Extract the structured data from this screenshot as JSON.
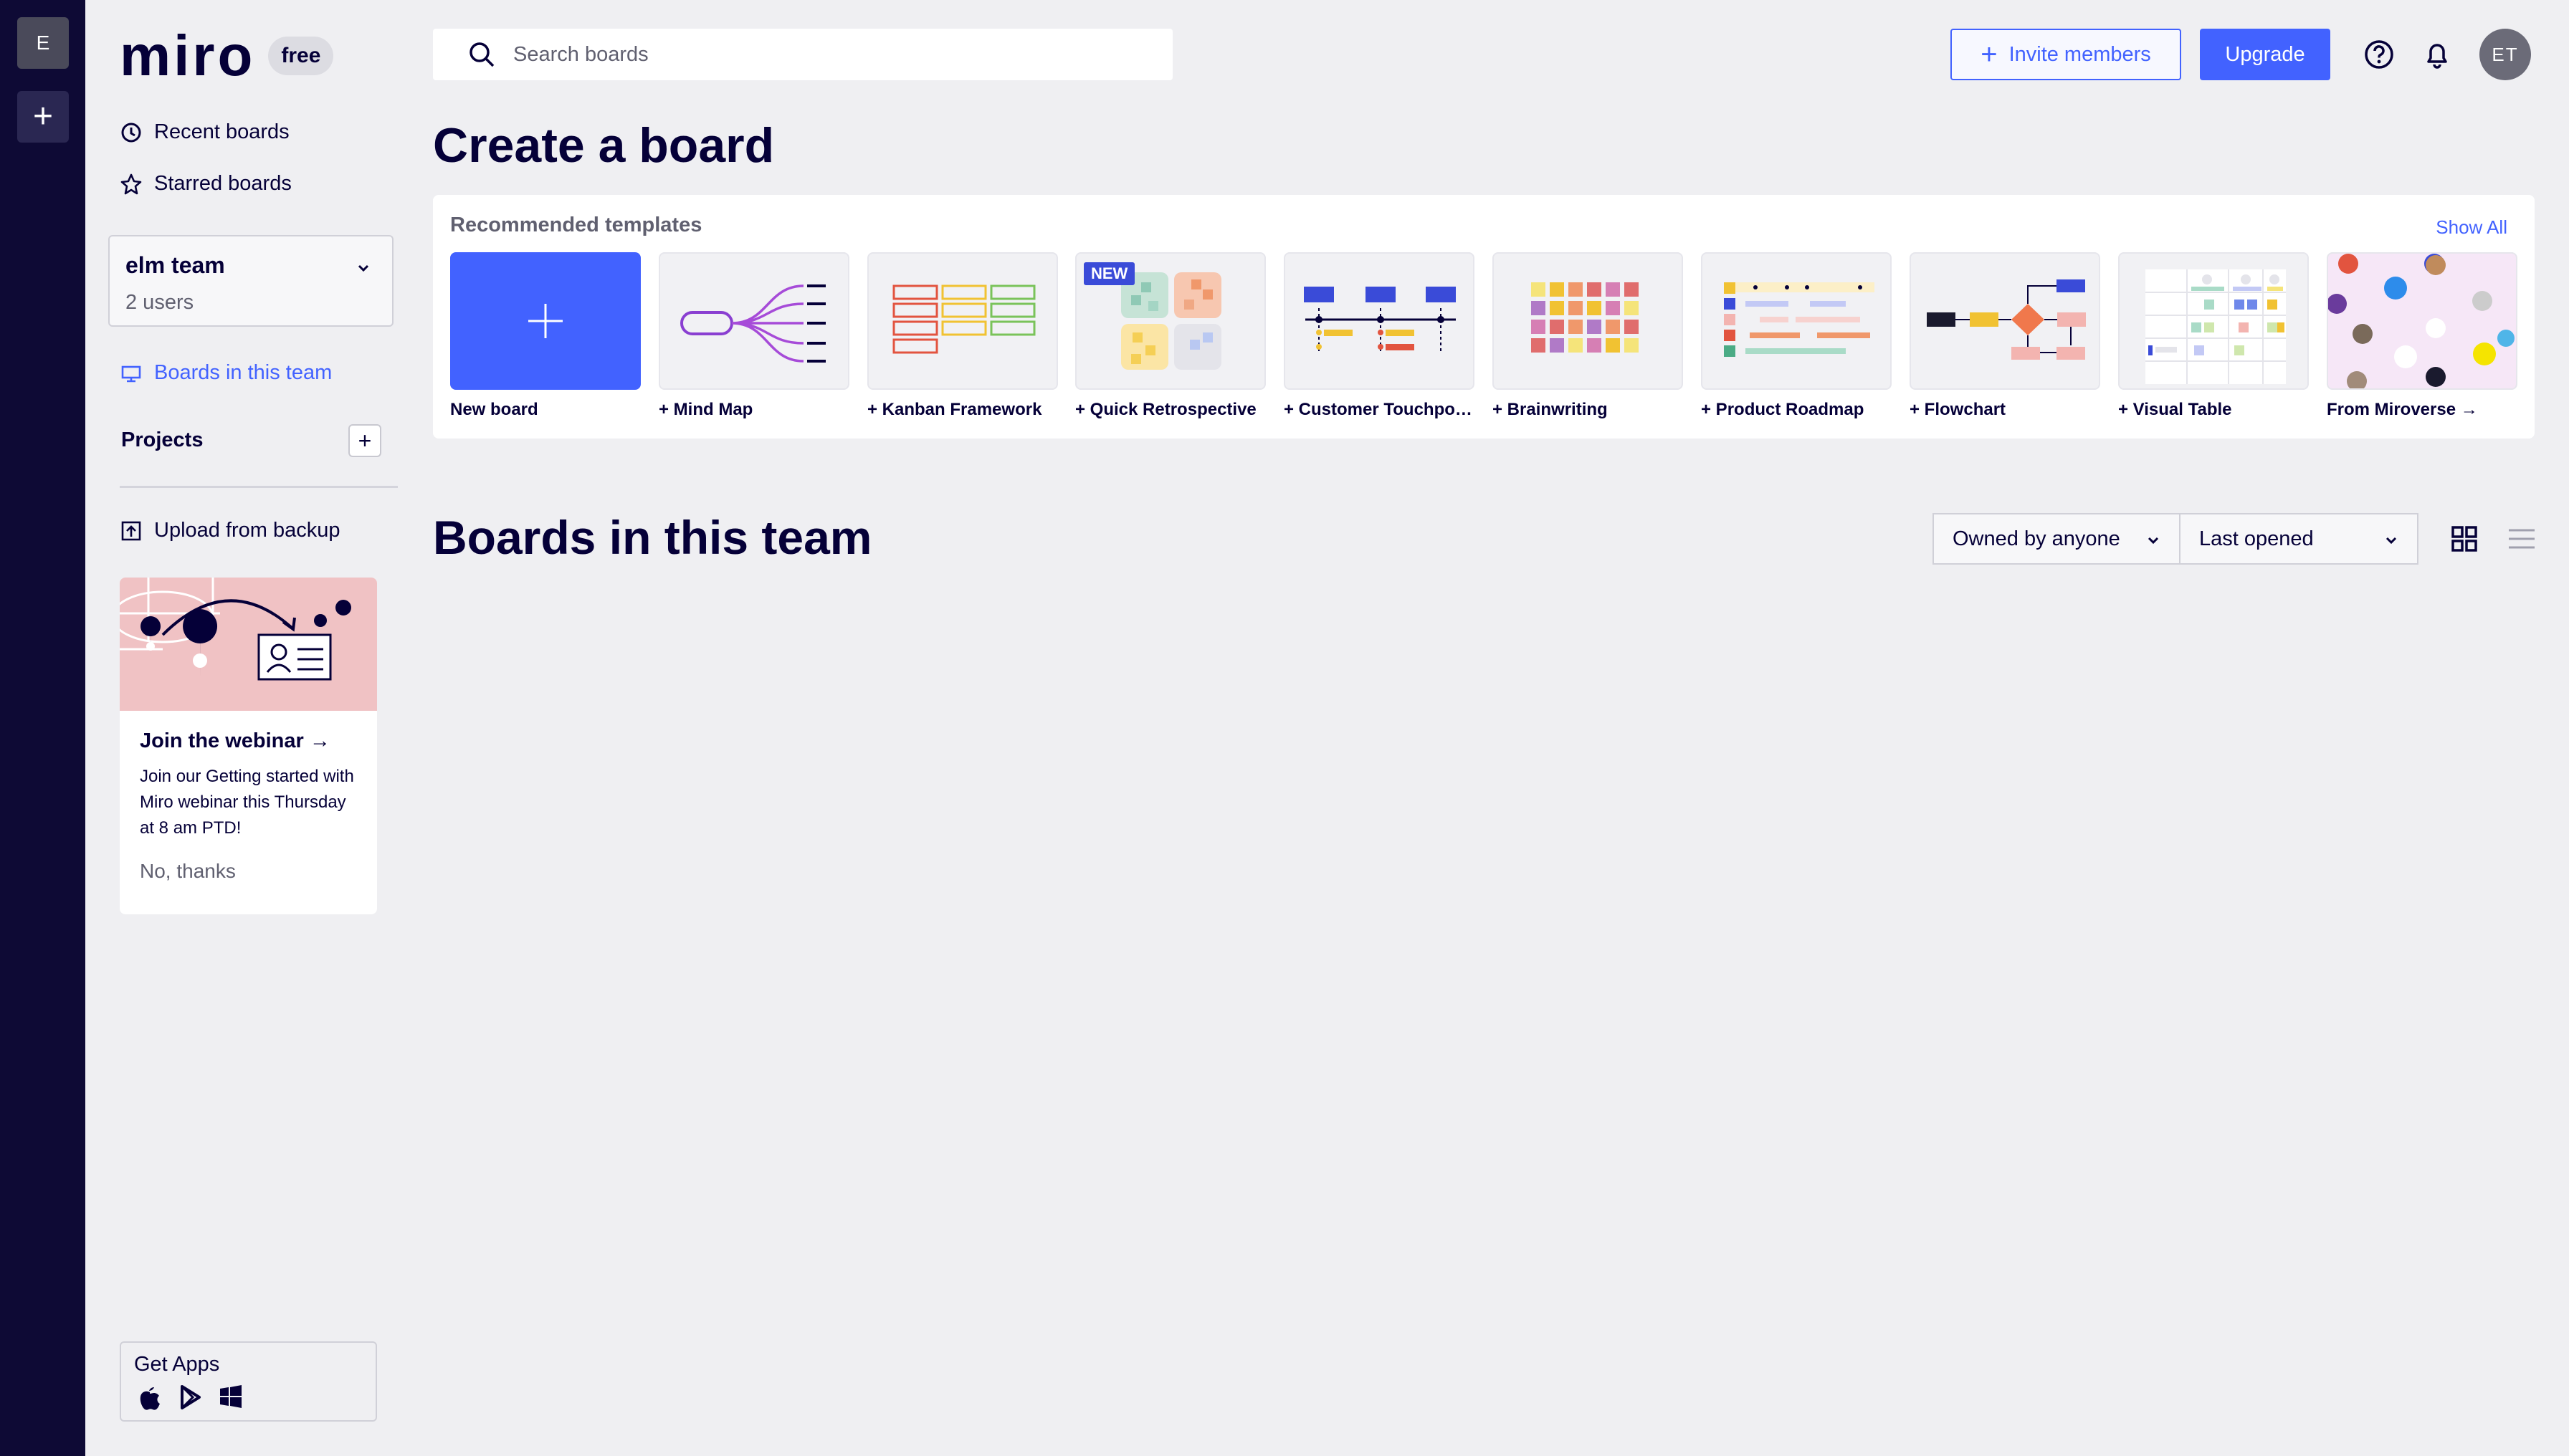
{
  "rail": {
    "team_initial": "E",
    "add_symbol": "+"
  },
  "logo": {
    "wordmark": "miro",
    "plan": "free"
  },
  "sidebar": {
    "recent": "Recent boards",
    "starred": "Starred boards",
    "team": {
      "name": "elm team",
      "users": "2 users"
    },
    "boards_in_team": "Boards in this team",
    "projects": "Projects",
    "projects_add": "+",
    "upload": "Upload from backup",
    "promo": {
      "title": "Join the webinar →",
      "body": "Join our Getting started with Miro webinar this Thursday at 8 am PTD!",
      "dismiss": "No, thanks"
    },
    "get_apps": "Get Apps"
  },
  "header": {
    "search_placeholder": "Search boards",
    "invite": "Invite members",
    "upgrade": "Upgrade",
    "avatar": "ET"
  },
  "create": {
    "title": "Create a board",
    "recommended": "Recommended templates",
    "show_all": "Show All",
    "badge_new": "NEW",
    "templates": [
      "New board",
      "+ Mind Map",
      "+ Kanban Framework",
      "+ Quick Retrospective",
      "+ Customer Touchpoint Map",
      "+ Brainwriting",
      "+ Product Roadmap",
      "+ Flowchart",
      "+ Visual Table",
      "From Miroverse →"
    ]
  },
  "boards": {
    "title": "Boards in this team",
    "owner_filter": "Owned by anyone",
    "sort": "Last opened"
  },
  "colors": {
    "accent": "#4262ff",
    "rail": "#0e0a35",
    "text": "#050038"
  }
}
